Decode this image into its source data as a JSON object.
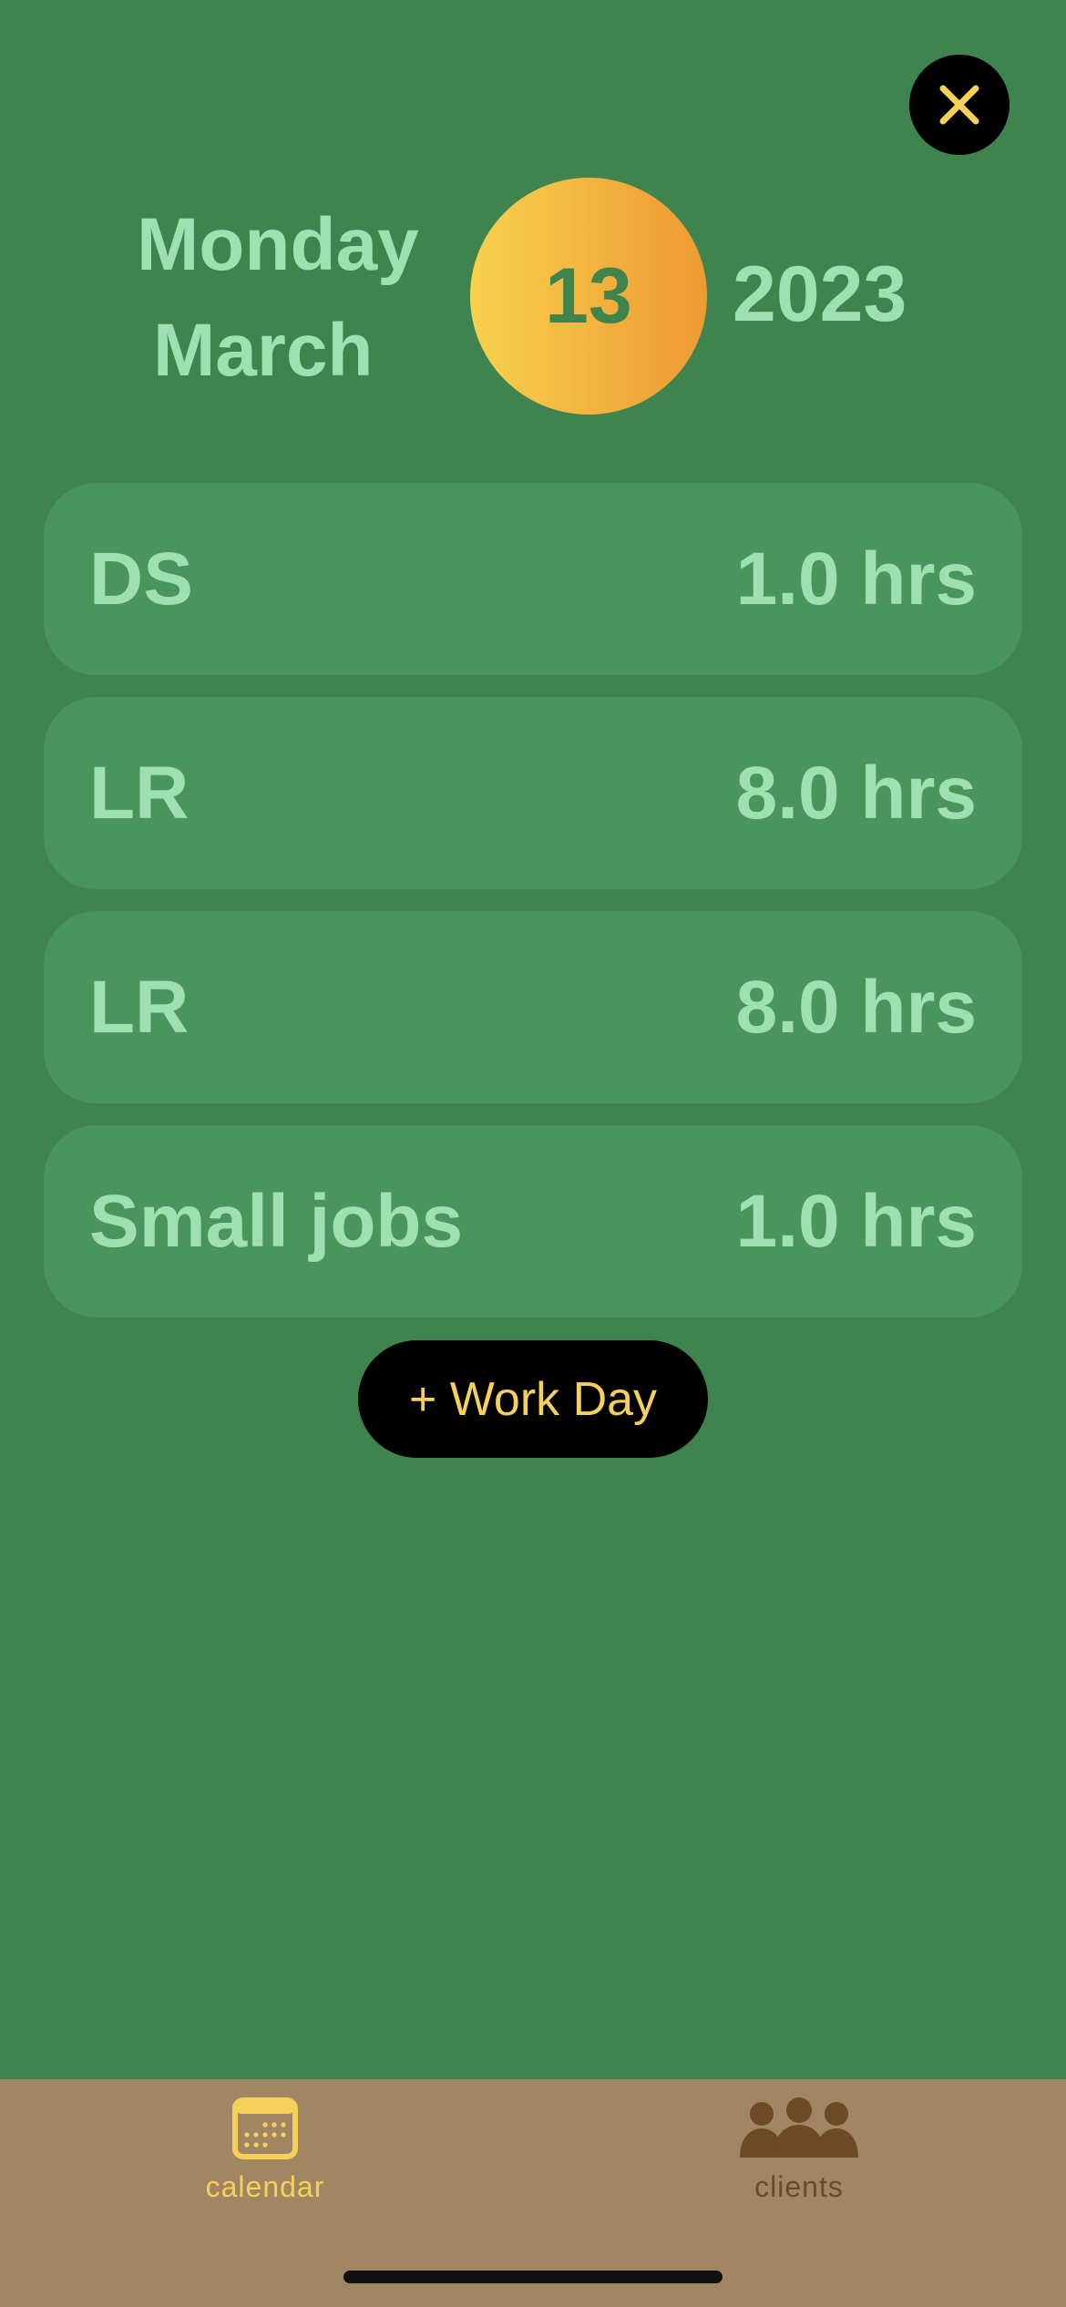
{
  "header": {
    "weekday": "Monday",
    "month": "March",
    "day": "13",
    "year": "2023"
  },
  "entries": [
    {
      "name": "DS",
      "hours": "1.0 hrs"
    },
    {
      "name": "LR",
      "hours": "8.0 hrs"
    },
    {
      "name": "LR",
      "hours": "8.0 hrs"
    },
    {
      "name": "Small jobs",
      "hours": "1.0 hrs"
    }
  ],
  "add_button": {
    "label": "+ Work Day"
  },
  "tabbar": {
    "tabs": [
      {
        "label": "calendar",
        "icon": "calendar-icon",
        "active": true
      },
      {
        "label": "clients",
        "icon": "people-icon",
        "active": false
      }
    ]
  },
  "colors": {
    "background": "#3f844e",
    "card": "#4a955d",
    "text_mint": "#9fe0b3",
    "accent_yellow": "#f6d15a",
    "tabbar": "#a08663",
    "inactive_tab": "#6b4a25"
  }
}
